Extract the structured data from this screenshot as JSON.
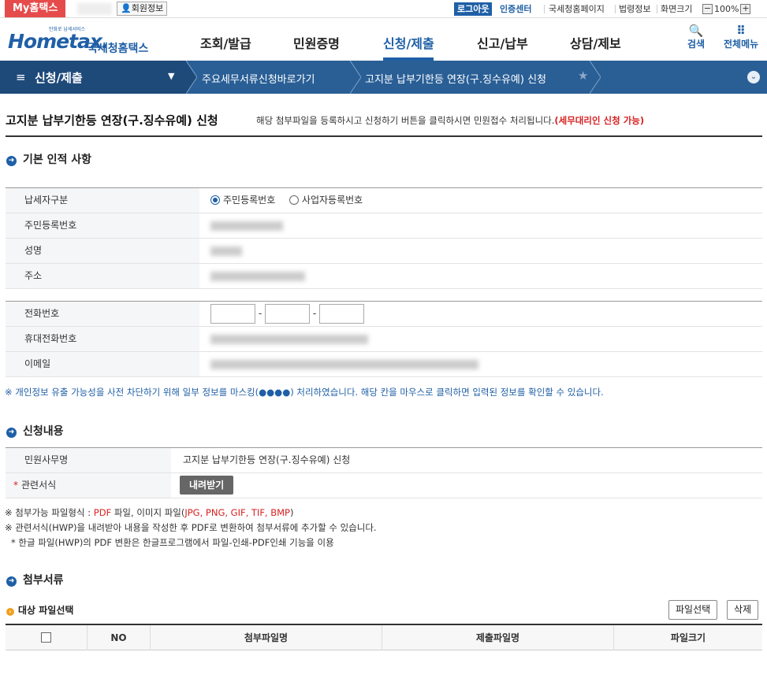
{
  "topbar": {
    "my_hometax": "My홈택스",
    "member_info": "회원정보",
    "logout": "로그아웃",
    "cert_center": "인증센터",
    "nts_homepage": "국세청홈페이지",
    "law_info": "법령정보",
    "screen_size": "화면크기",
    "zoom_minus": "−",
    "zoom_level": "100%",
    "zoom_plus": "+"
  },
  "logo": {
    "small": "만화로 납세서비스",
    "brand": "Hometax.",
    "korean": "국세청홈택스"
  },
  "gnb": [
    "조회/발급",
    "민원증명",
    "신청/제출",
    "신고/납부",
    "상담/제보"
  ],
  "header_icons": {
    "search": "검색",
    "all_menu": "전체메뉴"
  },
  "navbar": {
    "menu": "신청/제출",
    "crumb1": "주요세무서류신청바로가기",
    "crumb2": "고지분 납부기한등 연장(구.징수유예) 신청"
  },
  "page": {
    "title": "고지분 납부기한등 연장(구.징수유예) 신청",
    "desc": "해당 첨부파일을 등록하시고 신청하기 버튼을 클릭하시면 민원접수 처리됩니다.",
    "desc_red": "(세무대리인 신청 가능)"
  },
  "section_basic": {
    "title": "기본 인적 사항",
    "labels": {
      "taxpayer_type": "납세자구분",
      "rrn": "주민등록번호",
      "name": "성명",
      "address": "주소",
      "phone": "전화번호",
      "mobile": "휴대전화번호",
      "email": "이메일"
    },
    "radio_rrn": "주민등록번호",
    "radio_brn": "사업자등록번호",
    "phone_sep": "-",
    "privacy_note": "※ 개인정보 유출 가능성을 사전 차단하기 위해 일부 정보를 마스킹(●●●●) 처리하였습니다. 해당 칸을 마우스로 클릭하면 입력된 정보를 확인할 수 있습니다."
  },
  "section_request": {
    "title": "신청내용",
    "label_service": "민원사무명",
    "service_value": "고지분 납부기한등 연장(구.징수유예) 신청",
    "required_mark": "*",
    "label_form": "관련서식",
    "download": "내려받기",
    "note1_prefix": "※ 첨부가능 파일형식 : ",
    "note1_pdf": "PDF",
    "note1_mid": " 파일, 이미지 파일(",
    "note1_types": "JPG, PNG, GIF, TIF, BMP",
    "note1_end": ")",
    "note2": "※ 관련서식(HWP)을 내려받아 내용을 작성한 후 PDF로 변환하여 첨부서류에 추가할 수 있습니다.",
    "note3": "* 한글 파일(HWP)의 PDF 변환은 한글프로그램에서 파일-인쇄-PDF인쇄 기능을 이용"
  },
  "section_attach": {
    "title": "첨부서류",
    "subtitle": "대상 파일선택",
    "file_select": "파일선택",
    "delete": "삭제",
    "columns": [
      "NO",
      "첨부파일명",
      "제출파일명",
      "파일크기"
    ]
  },
  "colors": {
    "brand": "#1f5fa6",
    "nav": "#2a5f96",
    "red": "#d82121"
  }
}
